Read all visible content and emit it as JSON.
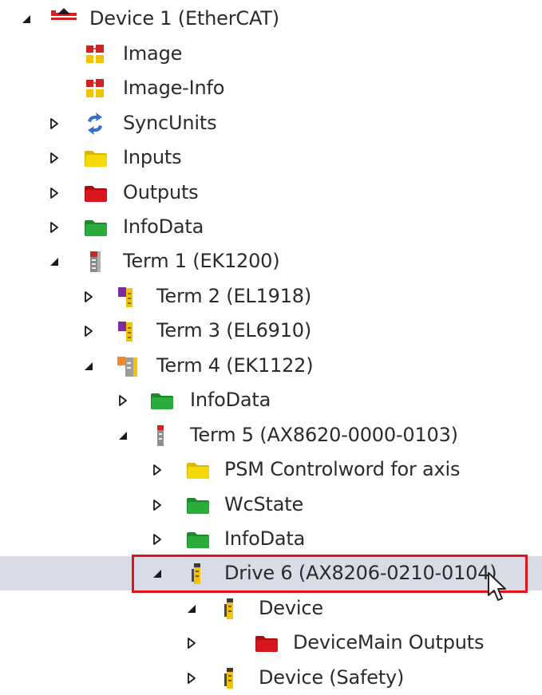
{
  "tree": {
    "selected_index": 16,
    "rows": [
      {
        "label": "Device 1 (EtherCAT)",
        "icon": "ethercat-device-icon",
        "expander": "expanded",
        "level": 0
      },
      {
        "label": "Image",
        "icon": "image-icon",
        "expander": "none",
        "level": 1
      },
      {
        "label": "Image-Info",
        "icon": "image-info-icon",
        "expander": "none",
        "level": 1
      },
      {
        "label": "SyncUnits",
        "icon": "sync-units-icon",
        "expander": "collapsed",
        "level": 1
      },
      {
        "label": "Inputs",
        "icon": "inputs-folder-icon",
        "expander": "collapsed",
        "level": 1
      },
      {
        "label": "Outputs",
        "icon": "outputs-folder-icon",
        "expander": "collapsed",
        "level": 1
      },
      {
        "label": "InfoData",
        "icon": "infodata-folder-icon",
        "expander": "collapsed",
        "level": 1
      },
      {
        "label": "Term 1 (EK1200)",
        "icon": "coupler-terminal-icon",
        "expander": "expanded",
        "level": 1
      },
      {
        "label": "Term 2 (EL1918)",
        "icon": "safety-terminal-icon",
        "expander": "collapsed",
        "level": 2
      },
      {
        "label": "Term 3 (EL6910)",
        "icon": "safety-terminal-icon",
        "expander": "collapsed",
        "level": 2
      },
      {
        "label": "Term 4 (EK1122)",
        "icon": "junction-terminal-icon",
        "expander": "expanded",
        "level": 2
      },
      {
        "label": "InfoData",
        "icon": "infodata-folder-icon",
        "expander": "collapsed",
        "level": 3
      },
      {
        "label": "Term 5 (AX8620-0000-0103)",
        "icon": "drive-module-icon",
        "expander": "expanded",
        "level": 3
      },
      {
        "label": "PSM Controlword for axis",
        "icon": "inputs-folder-icon",
        "expander": "collapsed",
        "level": 4
      },
      {
        "label": "WcState",
        "icon": "infodata-folder-icon",
        "expander": "collapsed",
        "level": 4
      },
      {
        "label": "InfoData",
        "icon": "infodata-folder-icon",
        "expander": "collapsed",
        "level": 4
      },
      {
        "label": "Drive 6 (AX8206-0210-0104)",
        "icon": "drive-icon",
        "expander": "expanded",
        "level": 4
      },
      {
        "label": "Device",
        "icon": "drive-icon",
        "expander": "expanded",
        "level": 5
      },
      {
        "label": "DeviceMain Outputs",
        "icon": "outputs-folder-icon",
        "expander": "collapsed",
        "level": 6
      },
      {
        "label": "Device (Safety)",
        "icon": "drive-icon",
        "expander": "collapsed",
        "level": 5
      }
    ]
  },
  "colors": {
    "selection_bg": "#d9dbe6",
    "highlight_border": "#e0151c",
    "folder_yellow": "#f5d90a",
    "folder_red": "#c8141c",
    "folder_green": "#28a83a"
  }
}
